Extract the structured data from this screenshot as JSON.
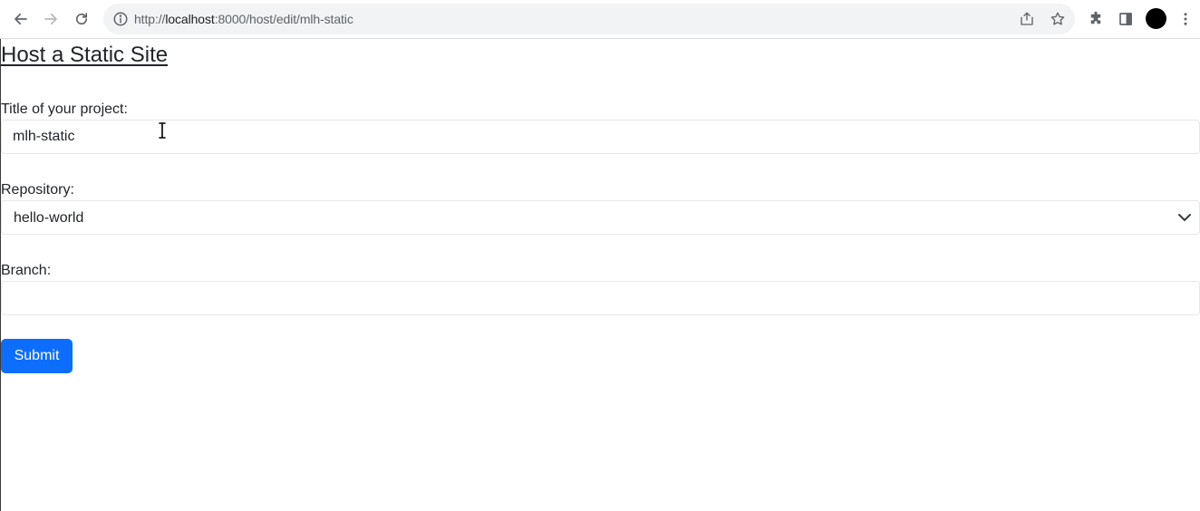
{
  "browser": {
    "url_prefix": "http://",
    "url_host": "localhost",
    "url_rest": ":8000/host/edit/mlh-static"
  },
  "page": {
    "title": "Host a Static Site"
  },
  "form": {
    "title_label": "Title of your project:",
    "title_value": "mlh-static",
    "repository_label": "Repository:",
    "repository_value": "hello-world",
    "branch_label": "Branch:",
    "branch_value": "",
    "submit_label": "Submit"
  },
  "colors": {
    "primary": "#0d6efd",
    "text": "#212529"
  },
  "icons": [
    "back-arrow-icon",
    "forward-arrow-icon",
    "reload-icon",
    "site-info-icon",
    "share-icon",
    "bookmark-star-icon",
    "extensions-icon",
    "side-panel-icon",
    "profile-avatar",
    "menu-kebab-icon",
    "chevron-down-icon",
    "text-cursor-icon"
  ]
}
